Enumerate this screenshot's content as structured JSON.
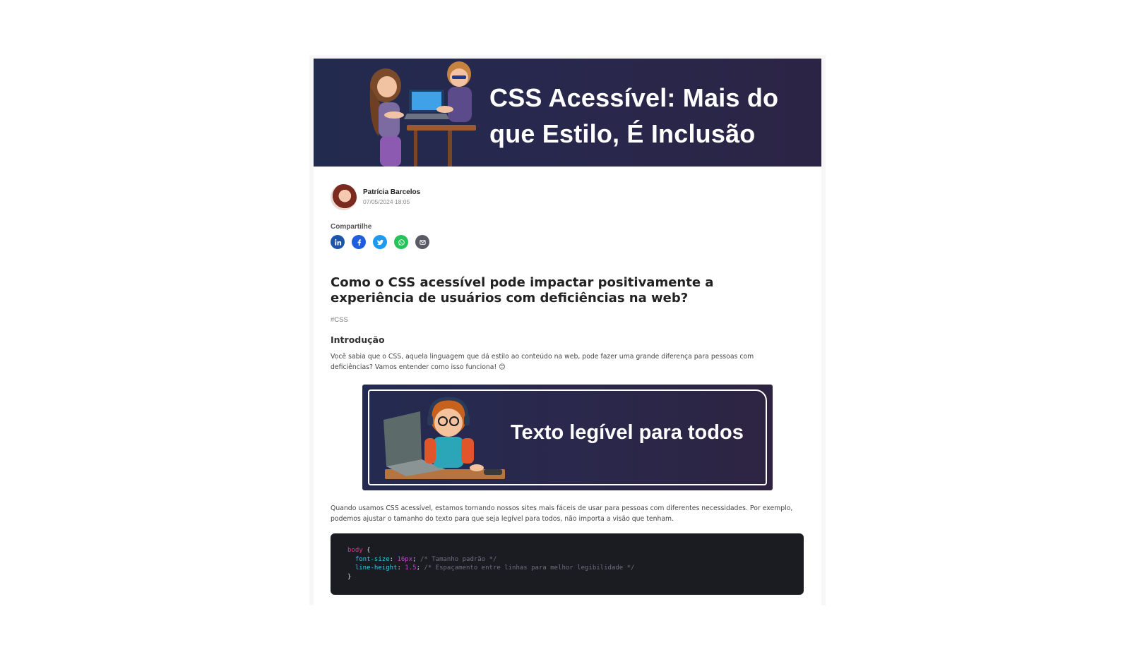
{
  "hero": {
    "title": "CSS Acessível: Mais do que Estilo, É Inclusão"
  },
  "author": {
    "name": "Patrícia Barcelos",
    "date": "07/05/2024 18:05"
  },
  "share": {
    "label": "Compartilhe",
    "buttons": [
      {
        "icon": "linkedin-icon",
        "color": "#1d56a8"
      },
      {
        "icon": "facebook-icon",
        "color": "#1f5ce0"
      },
      {
        "icon": "twitter-icon",
        "color": "#1d9bf0"
      },
      {
        "icon": "whatsapp-icon",
        "color": "#25c35a"
      },
      {
        "icon": "email-icon",
        "color": "#5a5a66"
      }
    ]
  },
  "article": {
    "headline": "Como o CSS acessível pode impactar positivamente a experiência de usuários com deficiências na web?",
    "tag": "#CSS",
    "section_title": "Introdução",
    "paragraph_1": "Você sabia que o CSS, aquela linguagem que dá estilo ao conteúdo na web, pode fazer uma grande diferença para pessoas com deficiências? Vamos entender como isso funciona! 😊",
    "figure_title": "Texto legível para todos",
    "paragraph_2": "Quando usamos CSS acessível, estamos tornando nossos sites mais fáceis de usar para pessoas com diferentes necessidades. Por exemplo, podemos ajustar o tamanho do texto para que seja legível para todos, não importa a visão que tenham."
  },
  "code": {
    "selector": "body",
    "open_brace": " {",
    "lines": [
      {
        "prop": "font-size",
        "value": "16px",
        "comment": "/* Tamanho padrão */"
      },
      {
        "prop": "line-height",
        "value": "1.5",
        "comment": "/* Espaçamento entre linhas para melhor legibilidade */"
      }
    ],
    "close_brace": "}"
  }
}
